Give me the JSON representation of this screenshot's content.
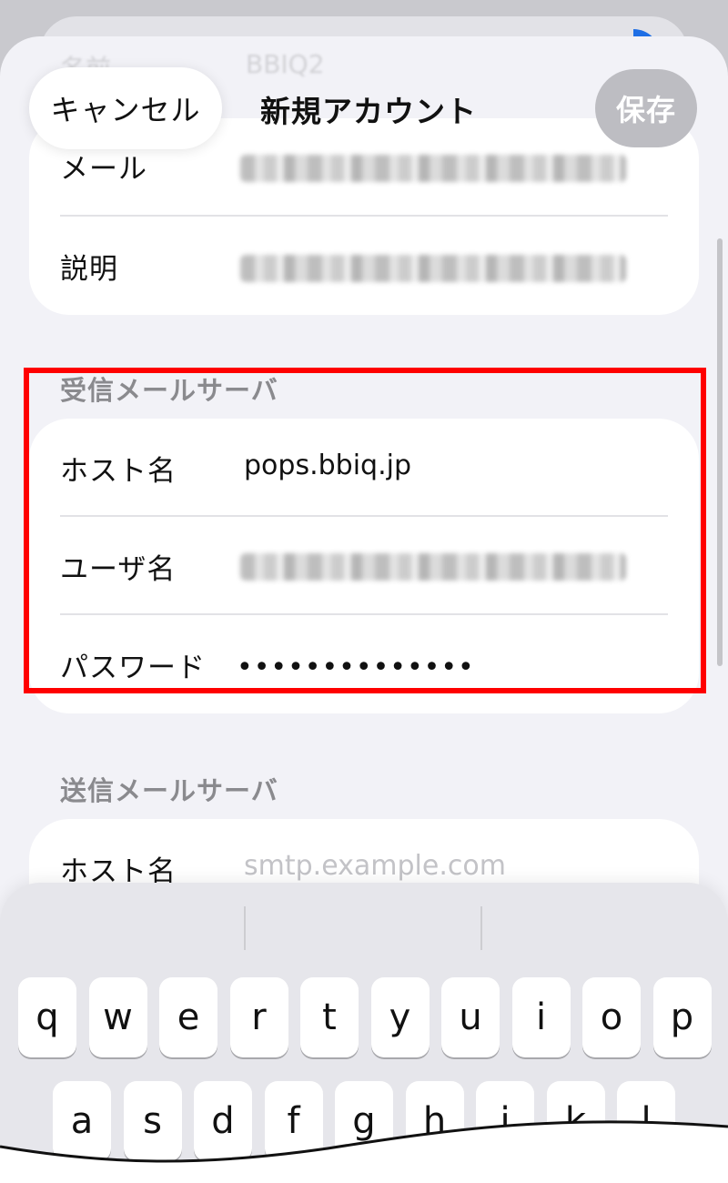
{
  "nav": {
    "cancel_label": "キャンセル",
    "title": "新規アカウント",
    "save_label": "保存"
  },
  "behind": {
    "label": "名前",
    "value": "BBIQ2"
  },
  "account": {
    "rows": [
      {
        "label": "メール"
      },
      {
        "label": "説明"
      }
    ]
  },
  "incoming": {
    "header": "受信メールサーバ",
    "host_label": "ホスト名",
    "host_value": "pops.bbiq.jp",
    "user_label": "ユーザ名",
    "password_label": "パスワード",
    "password_value": "••••••••••••••"
  },
  "outgoing": {
    "header": "送信メールサーバ",
    "host_label": "ホスト名",
    "host_placeholder": "smtp.example.com"
  },
  "keyboard": {
    "row1": [
      "q",
      "w",
      "e",
      "r",
      "t",
      "y",
      "u",
      "i",
      "o",
      "p"
    ],
    "row2": [
      "a",
      "s",
      "d",
      "f",
      "g",
      "h",
      "j",
      "k",
      "l"
    ]
  },
  "colors": {
    "highlight": "#ff0000",
    "save_disabled": "#bdbdc2"
  }
}
